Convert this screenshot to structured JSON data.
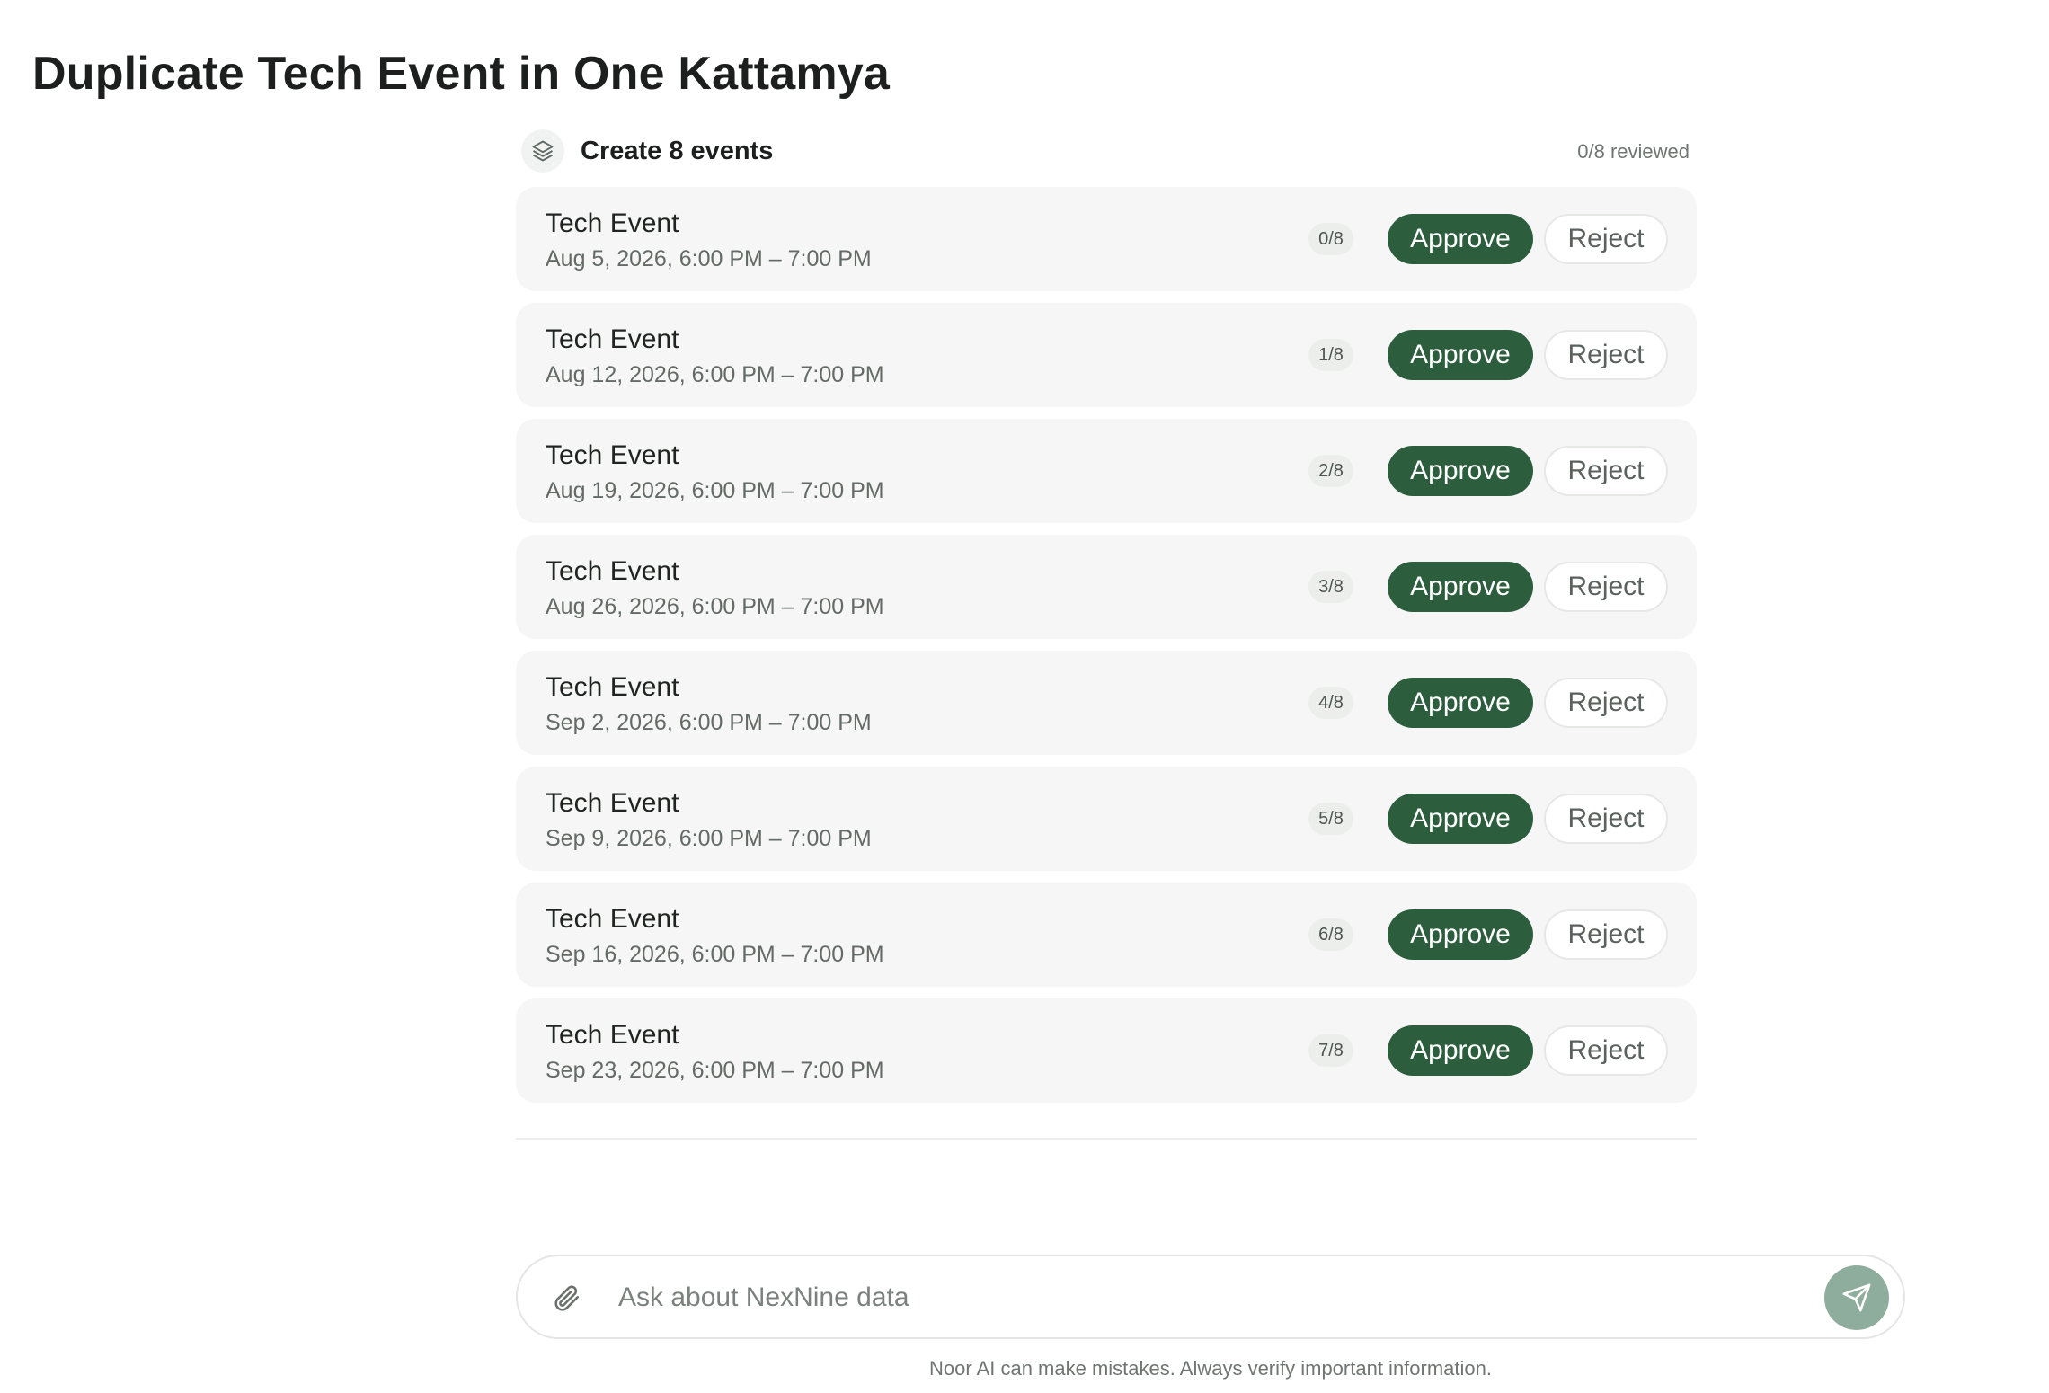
{
  "page": {
    "title": "Duplicate Tech Event in One Kattamya"
  },
  "batch": {
    "title": "Create 8 events",
    "reviewed": "0/8 reviewed",
    "icon": "layers-icon",
    "events": [
      {
        "name": "Tech Event",
        "time": "Aug 5, 2026, 6:00 PM – 7:00 PM",
        "index": "0/8",
        "approve": "Approve",
        "reject": "Reject"
      },
      {
        "name": "Tech Event",
        "time": "Aug 12, 2026, 6:00 PM – 7:00 PM",
        "index": "1/8",
        "approve": "Approve",
        "reject": "Reject"
      },
      {
        "name": "Tech Event",
        "time": "Aug 19, 2026, 6:00 PM – 7:00 PM",
        "index": "2/8",
        "approve": "Approve",
        "reject": "Reject"
      },
      {
        "name": "Tech Event",
        "time": "Aug 26, 2026, 6:00 PM – 7:00 PM",
        "index": "3/8",
        "approve": "Approve",
        "reject": "Reject"
      },
      {
        "name": "Tech Event",
        "time": "Sep 2, 2026, 6:00 PM – 7:00 PM",
        "index": "4/8",
        "approve": "Approve",
        "reject": "Reject"
      },
      {
        "name": "Tech Event",
        "time": "Sep 9, 2026, 6:00 PM – 7:00 PM",
        "index": "5/8",
        "approve": "Approve",
        "reject": "Reject"
      },
      {
        "name": "Tech Event",
        "time": "Sep 16, 2026, 6:00 PM – 7:00 PM",
        "index": "6/8",
        "approve": "Approve",
        "reject": "Reject"
      },
      {
        "name": "Tech Event",
        "time": "Sep 23, 2026, 6:00 PM – 7:00 PM",
        "index": "7/8",
        "approve": "Approve",
        "reject": "Reject"
      }
    ]
  },
  "composer": {
    "placeholder": "Ask about NexNine data",
    "attach_icon": "paperclip-icon",
    "send_icon": "send-icon"
  },
  "footer": {
    "disclaimer": "Noor AI can make mistakes. Always verify important information."
  },
  "colors": {
    "accent": "#2c5e3e",
    "send_button": "#8fad9c",
    "card_background": "#f5f6f5"
  }
}
